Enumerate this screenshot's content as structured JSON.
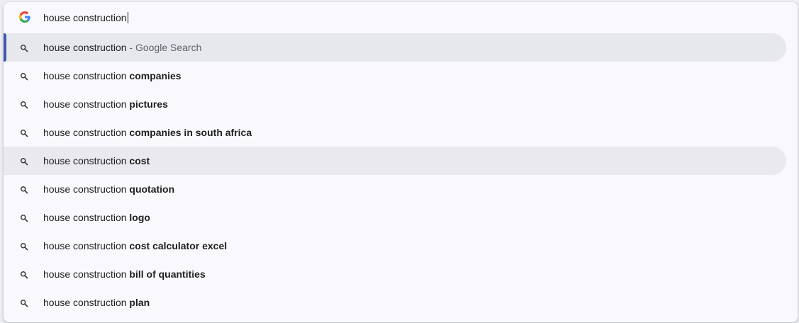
{
  "omnibox": {
    "query": "house construction"
  },
  "suggestions": [
    {
      "prefix": "house construction",
      "bold": "",
      "suffix": " - Google Search",
      "state": "selected"
    },
    {
      "prefix": "house construction ",
      "bold": "companies",
      "suffix": "",
      "state": "normal"
    },
    {
      "prefix": "house construction ",
      "bold": "pictures",
      "suffix": "",
      "state": "normal"
    },
    {
      "prefix": "house construction ",
      "bold": "companies in south africa",
      "suffix": "",
      "state": "normal"
    },
    {
      "prefix": "house construction ",
      "bold": "cost",
      "suffix": "",
      "state": "hovered"
    },
    {
      "prefix": "house construction ",
      "bold": "quotation",
      "suffix": "",
      "state": "normal"
    },
    {
      "prefix": "house construction ",
      "bold": "logo",
      "suffix": "",
      "state": "normal"
    },
    {
      "prefix": "house construction ",
      "bold": "cost calculator excel",
      "suffix": "",
      "state": "normal"
    },
    {
      "prefix": "house construction ",
      "bold": "bill of quantities",
      "suffix": "",
      "state": "normal"
    },
    {
      "prefix": "house construction ",
      "bold": "plan",
      "suffix": "",
      "state": "normal"
    }
  ],
  "icons": {
    "input": "google-g-icon",
    "suggestion": "search-icon"
  },
  "colors": {
    "selected_bar": "#3c59a8",
    "selected_bg": "#e7e7ee",
    "dropdown_bg": "#f8f8fd",
    "muted_text": "#5f6368"
  }
}
